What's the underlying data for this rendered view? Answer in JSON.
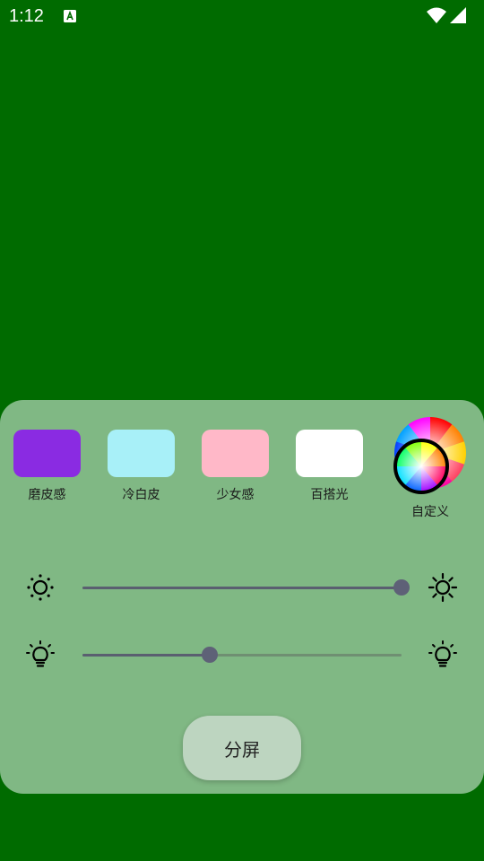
{
  "status_bar": {
    "time": "1:12",
    "icons": [
      "app-notification-icon",
      "wifi-icon",
      "signal-icon"
    ]
  },
  "presets": [
    {
      "label": "磨皮感",
      "color": "#8a2be2"
    },
    {
      "label": "冷白皮",
      "color": "#a8f0f8"
    },
    {
      "label": "少女感",
      "color": "#ffb8c8"
    },
    {
      "label": "百搭光",
      "color": "#ffffff"
    }
  ],
  "custom": {
    "label": "自定义",
    "icon": "color-wheel-icon"
  },
  "sliders": {
    "brightness": {
      "value_percent": 100,
      "icons": [
        "brightness-low-icon",
        "brightness-high-icon"
      ]
    },
    "color_temperature": {
      "value_percent": 40,
      "icons": [
        "bulb-icon",
        "bulb-icon"
      ]
    }
  },
  "split_button_label": "分屏",
  "colors": {
    "background": "#006b00",
    "panel": "#80b884",
    "slider_thumb": "#5e6177",
    "button": "#bdd5c0"
  }
}
